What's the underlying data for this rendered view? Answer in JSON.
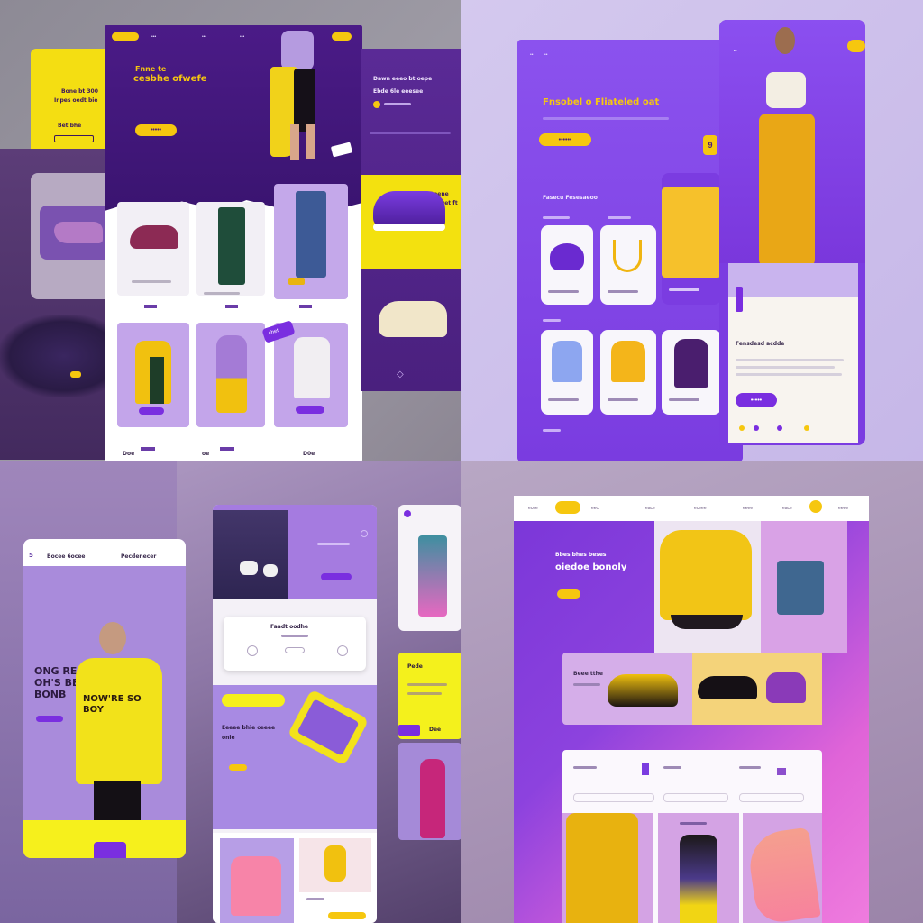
{
  "colors": {
    "purple": "#7a2ee0",
    "deep_purple": "#4d1a8a",
    "yellow": "#f6c70f",
    "pink": "#e878e6",
    "lavender": "#c9b2ef"
  },
  "q1": {
    "hero_kicker": "Fnne te",
    "hero_title": "cesbhe ofwefe",
    "side_card_line1": "Bone bt 300",
    "side_card_line2": "Inpes oedt bie",
    "side_card_label": "Bet bhe",
    "right_panel_title": "Dawn eeeo bt oepe",
    "right_panel_sub": "Ebde 6le eeesee",
    "shoe_promo": "Dnene bhte",
    "shoe_promo2": "ceewet ft",
    "footer_labels": [
      "Doe",
      "oe",
      "D0e"
    ],
    "ribbon": "chet"
  },
  "q2": {
    "headline": "Fnsobel o Fliateled oat",
    "section_label": "Fasecu Fesesaeoo",
    "badge": "9",
    "desc_title": "Fensdesd acdde",
    "icons": [
      "hat-icon",
      "necklace-icon",
      "bag-icon",
      "shirt-icon",
      "sweater-icon",
      "jacket-icon"
    ]
  },
  "q3": {
    "phone_header": "Bocee 6ocee",
    "phone_header_right": "Pecdenecer",
    "headline": "ONG RE OH'S BE BONB",
    "shirt_text": "NOW'RE SO BOY",
    "card_title": "Faadt oodhe",
    "promo_lines": "Eeeee bhie ceeee onie",
    "yellow_card_label": "Pede",
    "price_badge": "Dee"
  },
  "q4": {
    "nav_items": [
      "ecee",
      "eec",
      "eace",
      "eceee",
      "eeee",
      "eace",
      "eeee",
      "eeee"
    ],
    "hero_kicker": "Bbes bhes beses",
    "hero_title": "oiedoe bonoly",
    "strip_text": "Beee tthe"
  }
}
